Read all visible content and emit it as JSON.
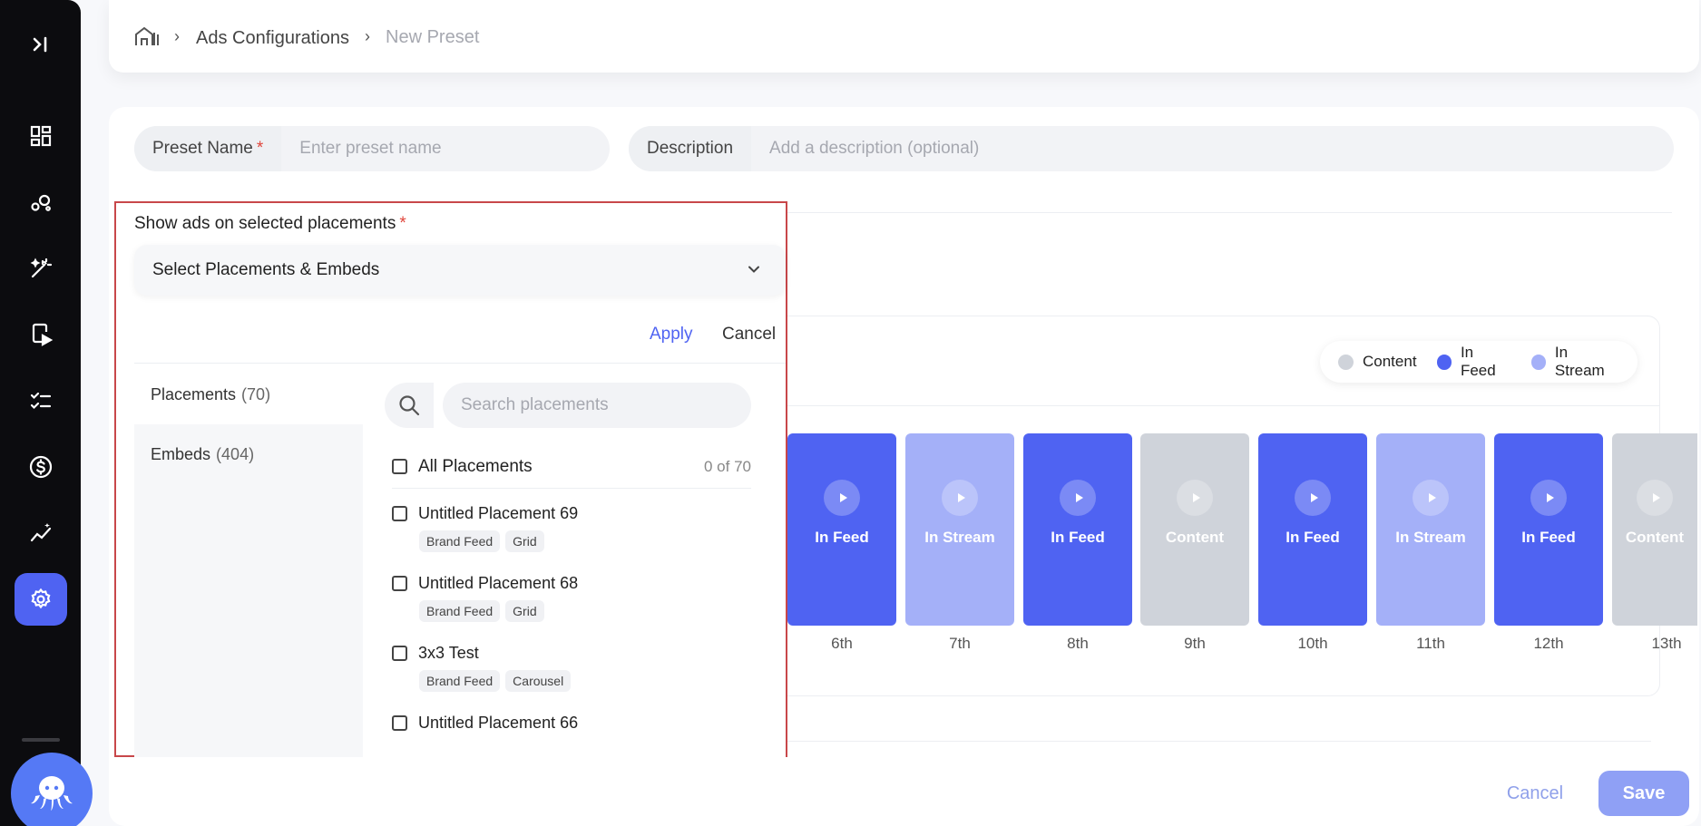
{
  "sidebar": {
    "items": [
      {
        "name": "collapse-icon"
      },
      {
        "name": "dashboard-icon"
      },
      {
        "name": "circles-icon"
      },
      {
        "name": "magic-wand-icon"
      },
      {
        "name": "video-device-icon"
      },
      {
        "name": "checklist-icon"
      },
      {
        "name": "dollar-icon"
      },
      {
        "name": "analytics-icon"
      },
      {
        "name": "settings-icon",
        "active": true
      }
    ],
    "accent": "#4f63f2"
  },
  "breadcrumb": {
    "home_icon": "home-icon",
    "items": [
      "Ads Configurations",
      "New Preset"
    ]
  },
  "form": {
    "preset_name_label": "Preset Name",
    "preset_name_required": "*",
    "preset_name_placeholder": "Enter preset name",
    "description_label": "Description",
    "description_placeholder": "Add a description (optional)"
  },
  "placements": {
    "title": "Show ads on selected placements",
    "required": "*",
    "selector_label": "Select Placements & Embeds",
    "apply": "Apply",
    "cancel": "Cancel",
    "tabs": [
      {
        "label": "Placements",
        "count": "(70)"
      },
      {
        "label": "Embeds",
        "count": "(404)"
      }
    ],
    "search_placeholder": "Search placements",
    "all_label": "All Placements",
    "all_count": "0 of 70",
    "list": [
      {
        "name": "Untitled Placement 69",
        "tags": [
          "Brand Feed",
          "Grid"
        ]
      },
      {
        "name": "Untitled Placement 68",
        "tags": [
          "Brand Feed",
          "Grid"
        ]
      },
      {
        "name": "3x3 Test",
        "tags": [
          "Brand Feed",
          "Carousel"
        ]
      },
      {
        "name": "Untitled Placement 66",
        "tags": []
      }
    ]
  },
  "preview": {
    "legend": [
      {
        "label": "Content",
        "color": "#cfd3da"
      },
      {
        "label": "In Feed",
        "color": "#4f63f2"
      },
      {
        "label": "In Stream",
        "color": "#a4b0f8"
      }
    ],
    "slots": [
      {
        "label": "In Feed",
        "order": "6th",
        "color": "#4f63f2"
      },
      {
        "label": "In Stream",
        "order": "7th",
        "color": "#a4b0f8"
      },
      {
        "label": "In Feed",
        "order": "8th",
        "color": "#4f63f2"
      },
      {
        "label": "Content",
        "order": "9th",
        "color": "#cfd3da"
      },
      {
        "label": "In Feed",
        "order": "10th",
        "color": "#4f63f2"
      },
      {
        "label": "In Stream",
        "order": "11th",
        "color": "#a4b0f8"
      },
      {
        "label": "In Feed",
        "order": "12th",
        "color": "#4f63f2"
      },
      {
        "label": "Content",
        "order": "13th",
        "color": "#cfd3da"
      }
    ]
  },
  "footer": {
    "cancel": "Cancel",
    "save": "Save"
  }
}
